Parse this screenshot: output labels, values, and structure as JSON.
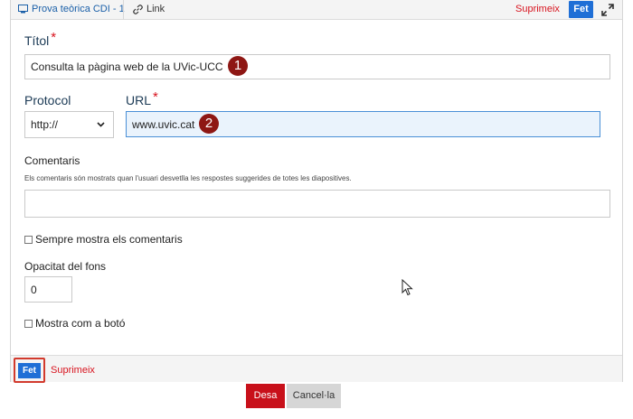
{
  "breadcrumb": {
    "parent_label": "Prova teòrica CDI - 1",
    "current_label": "Link"
  },
  "toolbar": {
    "delete_label": "Suprimeix",
    "done_label": "Fet"
  },
  "form": {
    "title": {
      "label": "Títol",
      "required_mark": "*",
      "value": "Consulta la pàgina web de la UVic-UCC",
      "marker": "1"
    },
    "protocol": {
      "label": "Protocol",
      "selected": "http://"
    },
    "url": {
      "label": "URL",
      "required_mark": "*",
      "value": "www.uvic.cat",
      "marker": "2"
    },
    "comments": {
      "label": "Comentaris",
      "description": "Els comentaris són mostrats quan l'usuari desvetlla les respostes suggerides de totes les diapositives.",
      "value": ""
    },
    "always_show_comments": {
      "label": "Sempre mostra els comentaris",
      "checked": false
    },
    "background_opacity": {
      "label": "Opacitat del fons",
      "value": "0"
    },
    "show_as_button": {
      "label": "Mostra com a botó",
      "checked": false
    }
  },
  "footer": {
    "done_label": "Fet",
    "delete_label": "Suprimeix"
  },
  "actions": {
    "save_label": "Desa",
    "cancel_label": "Cancel·la"
  },
  "colors": {
    "accent_blue": "#1f6fd6",
    "danger_red": "#d8141f",
    "marker": "#8e1714"
  }
}
